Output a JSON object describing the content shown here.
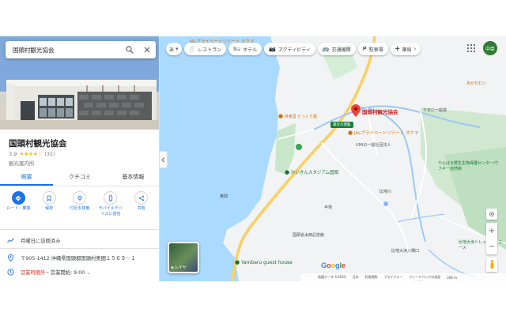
{
  "search": {
    "query": "国頭村観光協会"
  },
  "place": {
    "title": "国頭村観光協会",
    "rating": "3.9",
    "stars": "★★★★☆",
    "review_count": "(31)",
    "category": "観光案内所"
  },
  "tabs": [
    {
      "label": "概要"
    },
    {
      "label": "クチコミ"
    },
    {
      "label": "基本情報"
    }
  ],
  "actions": [
    {
      "label": "ルート・乗換",
      "icon": "directions-icon"
    },
    {
      "label": "保存",
      "icon": "bookmark-icon"
    },
    {
      "label": "付近を検索",
      "icon": "nearby-icon"
    },
    {
      "label": "モバイルデバイスに送信",
      "icon": "send-to-phone-icon"
    },
    {
      "label": "共有",
      "icon": "share-icon"
    }
  ],
  "info": {
    "visited": "月曜日に訪問済み",
    "address": "〒905-1412 沖縄県国頭郡国頭村奥間１５６９－１",
    "hours_status": "営業時間外",
    "hours_next": "・営業開始: 9:00"
  },
  "filter_chips": [
    {
      "label": "あ",
      "icon": "language-icon"
    },
    {
      "label": "レストラン",
      "icon": "restaurant-icon"
    },
    {
      "label": "ホテル",
      "icon": "hotel-icon"
    },
    {
      "label": "アクティビティ",
      "icon": "activity-icon"
    },
    {
      "label": "交通機関",
      "icon": "transit-icon"
    },
    {
      "label": "駐車場",
      "icon": "parking-icon"
    },
    {
      "label": "薬局",
      "icon": "pharmacy-icon"
    }
  ],
  "account": {
    "initials": "中臣"
  },
  "map_labels": {
    "selected_place": "国頭村観光協会",
    "place_sub": "最近の閲覧",
    "hotel": "JALプライベートリゾート オクマ",
    "restaurant": "浜食堂 とっくり屋",
    "stadium": "かいぎんスタジアム国頭",
    "guest_house": "Yambaru guest house",
    "memorial": "国頭省太郎記念館",
    "nature_center": "やんばる野生生物保護センター/ウフギー自然館",
    "trail": "比地大滝トレッキングコース",
    "village": "比地",
    "district": "奥間",
    "hamlet": "半地",
    "river": "比地川",
    "road": "比地大滝入場口",
    "school": "UMIの一般社団法人",
    "small_temple": "やまに一般境",
    "akogi": "あがちむい"
  },
  "layers_label": "レイヤ",
  "footer": {
    "copyright": "地図データ ©2023",
    "items": [
      "日本",
      "利用規約",
      "プライバシー",
      "フィードバックの送信",
      "200 m"
    ]
  },
  "brand": "Google"
}
